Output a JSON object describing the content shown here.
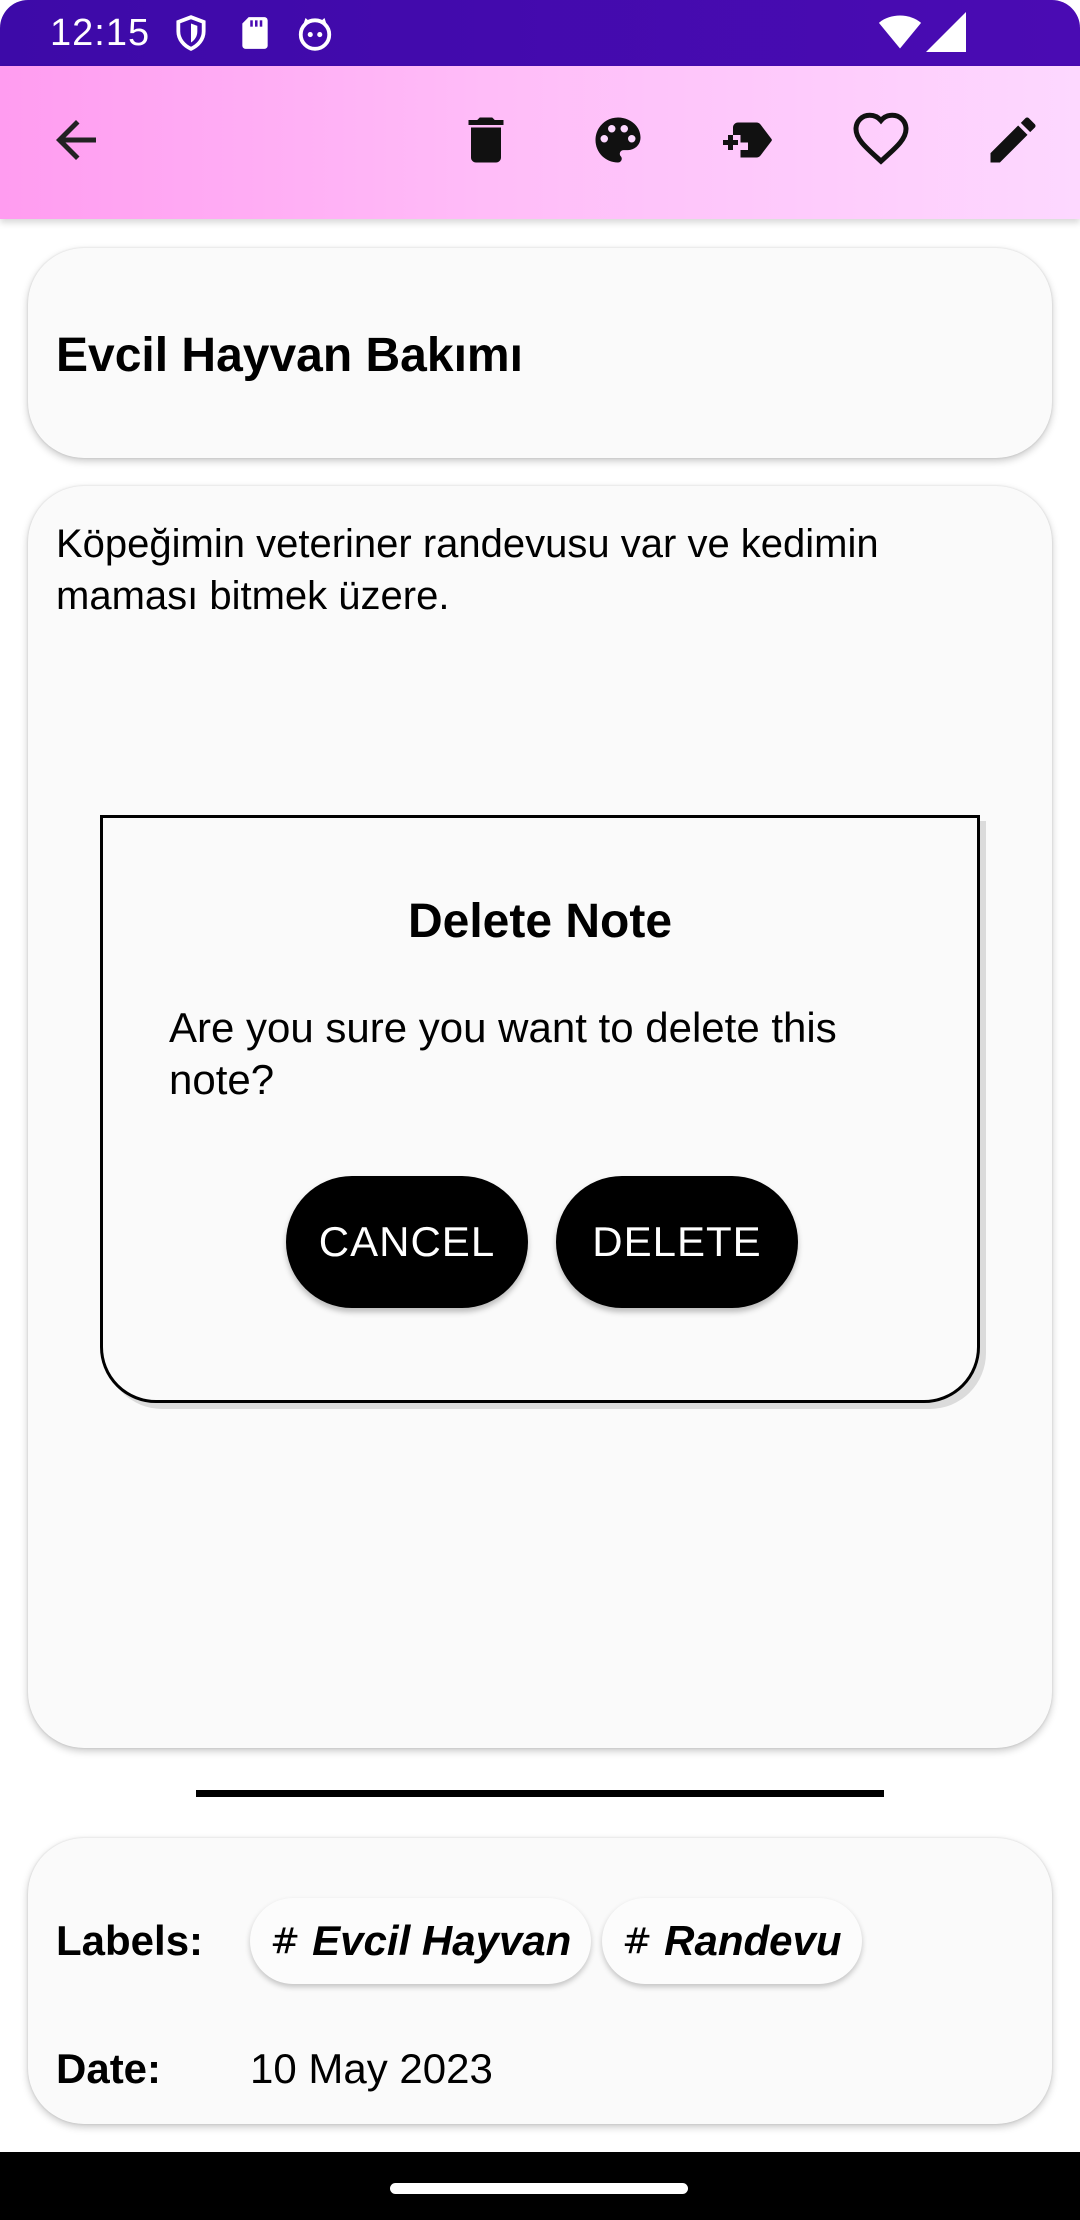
{
  "status_bar": {
    "time": "12:15",
    "left_icons": [
      "shield-icon",
      "sd-card-icon",
      "cat-face-icon"
    ],
    "right_icons": [
      "wifi-icon",
      "cellular-signal-icon"
    ]
  },
  "app_bar": {
    "background_colors": [
      "#ff9cf0",
      "#fdd8ff"
    ],
    "actions": [
      "back-arrow-icon",
      "delete-icon",
      "palette-icon",
      "add-label-icon",
      "favorite-heart-icon",
      "edit-pencil-icon"
    ]
  },
  "note": {
    "title": "Evcil Hayvan Bakımı",
    "body": "Köpeğimin veteriner randevusu var ve kedimin maması bitmek üzere."
  },
  "meta": {
    "labels_heading": "Labels:",
    "chips": [
      {
        "hash": "#",
        "text": "Evcil Hayvan"
      },
      {
        "hash": "#",
        "text": "Randevu"
      }
    ],
    "date_heading": "Date:",
    "date_value": "10 May 2023"
  },
  "dialog": {
    "title": "Delete Note",
    "message": "Are you sure you want to delete this note?",
    "cancel_label": "CANCEL",
    "delete_label": "DELETE"
  },
  "colors": {
    "status_bar": "#3d0aa8",
    "button_background": "#000000",
    "button_text": "#ffffff",
    "card_background": "#fafafa"
  }
}
